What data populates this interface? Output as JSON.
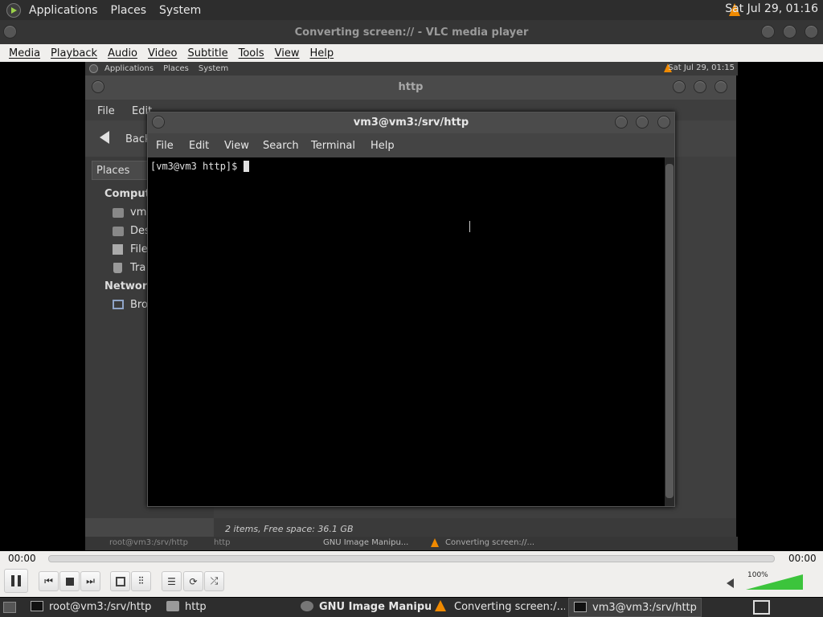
{
  "top_panel": {
    "menus": [
      "Applications",
      "Places",
      "System"
    ],
    "clock": "Sat Jul 29, 01:16"
  },
  "vlc": {
    "title": "Converting screen:// - VLC media player",
    "menu": [
      "Media",
      "Playback",
      "Audio",
      "Video",
      "Subtitle",
      "Tools",
      "View",
      "Help"
    ],
    "time_elapsed": "00:00",
    "time_total": "00:00",
    "volume": "100%",
    "volume_level": 1.0
  },
  "inner_panel": {
    "menus": [
      "Applications",
      "Places",
      "System"
    ],
    "clock": "Sat Jul 29, 01:15"
  },
  "file_manager": {
    "title": "http",
    "menu": [
      "File",
      "Edit"
    ],
    "back_label": "Back",
    "sidebar_header": "Places",
    "sidebar": {
      "computer_label": "Compute",
      "items": [
        "vm3",
        "Des",
        "File",
        "Tra"
      ],
      "network_label": "Network",
      "network_items": [
        "Bro"
      ]
    },
    "status": "2 items, Free space: 36.1 GB"
  },
  "inner_taskbar": {
    "items": [
      "root@vm3:/srv/http",
      "http",
      "GNU Image Manipu...",
      "Converting screen://..."
    ]
  },
  "terminal": {
    "title": "vm3@vm3:/srv/http",
    "menu": [
      "File",
      "Edit",
      "View",
      "Search",
      "Terminal",
      "Help"
    ],
    "prompt": "[vm3@vm3 http]$ "
  },
  "taskbar": {
    "items": [
      "root@vm3:/srv/http",
      "http",
      "GNU Image Manipu...",
      "Converting screen:/...",
      "vm3@vm3:/srv/http"
    ]
  },
  "colors": {
    "panel_bg": "#2d2d2d",
    "vlc_chrome": "#f0efed",
    "vlc_orange": "#f08a00",
    "volume_green": "#3cc43c"
  }
}
